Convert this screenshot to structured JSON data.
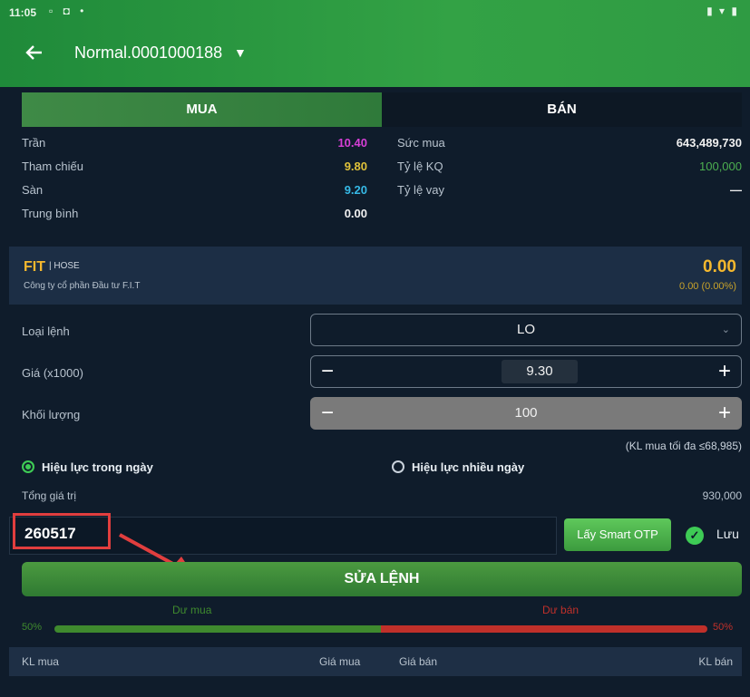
{
  "status_bar": {
    "time": "11:05",
    "left_icons": "▫ ◘ •",
    "right_icons": "▮ ▾ ▮"
  },
  "header": {
    "back_icon": "arrow-left-icon",
    "account": "Normal.0001000188"
  },
  "tabs": {
    "buy": "MUA",
    "sell": "BÁN"
  },
  "prices": {
    "ceiling_label": "Trần",
    "ceiling": "10.40",
    "reference_label": "Tham chiếu",
    "reference": "9.80",
    "floor_label": "Sàn",
    "floor": "9.20",
    "average_label": "Trung bình",
    "average": "0.00"
  },
  "account_info": {
    "buying_power_label": "Sức mua",
    "buying_power": "643,489,730",
    "margin_ratio_label": "Tỷ lệ KQ",
    "margin_ratio": "100,000",
    "loan_ratio_label": "Tỷ lệ vay",
    "loan_ratio": "—"
  },
  "stock": {
    "symbol": "FIT",
    "exchange": "| HOSE",
    "company": "Công ty cổ phần Đầu tư F.I.T",
    "price": "0.00",
    "change": "0.00 (0.00%)"
  },
  "order": {
    "type_label": "Loại lệnh",
    "type_value": "LO",
    "price_label": "Giá (x1000)",
    "price_value": "9.30",
    "qty_label": "Khối lượng",
    "qty_value": "100",
    "max_note": "(KL mua tối đa ≤68,985)",
    "validity_today": "Hiệu lực trong ngày",
    "validity_multi": "Hiệu lực nhiều ngày",
    "total_label": "Tổng giá trị",
    "total_value": "930,000"
  },
  "otp": {
    "value": "260517",
    "button": "Lấy Smart OTP",
    "save_label": "Lưu"
  },
  "submit": "SỬA LỆNH",
  "balance": {
    "buy_label": "Dư mua",
    "sell_label": "Dư bán",
    "buy_pct": "50%",
    "sell_pct": "50%",
    "buy_fraction": 0.5
  },
  "order_book": {
    "buy_qty": "KL mua",
    "buy_price": "Giá mua",
    "sell_price": "Giá bán",
    "sell_qty": "KL bán"
  },
  "colors": {
    "accent": "#33a245",
    "ceiling": "#d63fd6",
    "reference": "#e0c23a",
    "floor": "#36b9e6",
    "highlight": "#e13e3e"
  }
}
